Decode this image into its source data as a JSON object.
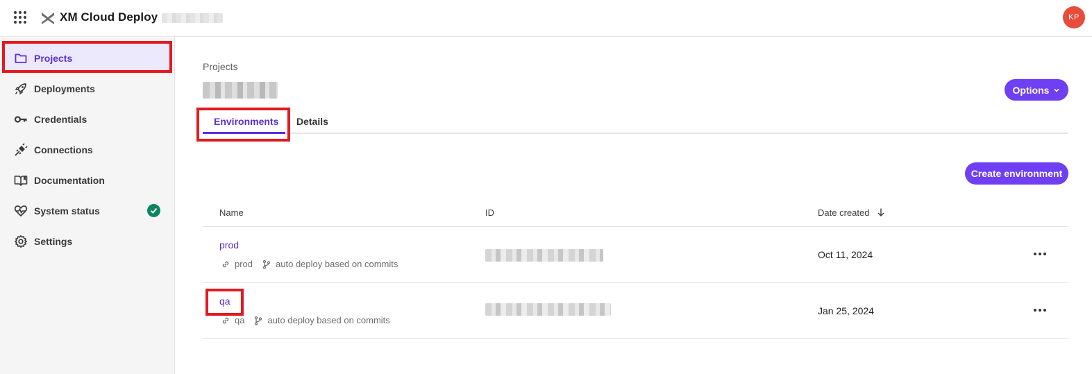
{
  "app": {
    "title": "XM Cloud Deploy",
    "avatar_initials": "KP",
    "avatar_color": "#e74c3c"
  },
  "sidebar": {
    "items": [
      {
        "label": "Projects",
        "icon": "folder-icon",
        "active": true
      },
      {
        "label": "Deployments",
        "icon": "rocket-icon"
      },
      {
        "label": "Credentials",
        "icon": "key-icon"
      },
      {
        "label": "Connections",
        "icon": "plug-icon"
      },
      {
        "label": "Documentation",
        "icon": "book-icon"
      },
      {
        "label": "System status",
        "icon": "heartbeat-icon",
        "status": "ok"
      },
      {
        "label": "Settings",
        "icon": "gear-icon"
      }
    ]
  },
  "main": {
    "breadcrumb": "Projects",
    "options_label": "Options",
    "tabs": [
      {
        "label": "Environments",
        "active": true
      },
      {
        "label": "Details"
      }
    ],
    "create_label": "Create environment",
    "table": {
      "headers": {
        "name": "Name",
        "id": "ID",
        "date": "Date created"
      },
      "rows": [
        {
          "name": "prod",
          "branch": "prod",
          "deploy": "auto deploy based on commits",
          "date": "Oct 11, 2024"
        },
        {
          "name": "qa",
          "branch": "qa",
          "deploy": "auto deploy based on commits",
          "date": "Jan 25, 2024"
        }
      ]
    }
  },
  "colors": {
    "accent": "#6e3ff3",
    "highlight": "#e3191f",
    "status_ok": "#0d8563"
  }
}
